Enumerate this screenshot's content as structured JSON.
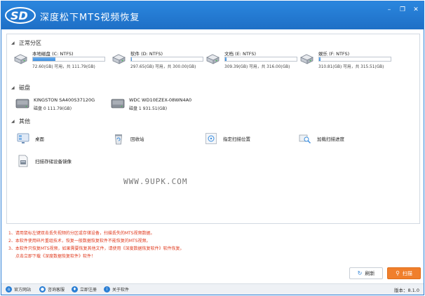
{
  "app": {
    "title": "深度松下MTS视频恢复",
    "logo_text": "SD"
  },
  "window_controls": {
    "minimize": "–",
    "restore": "❐",
    "close": "✕"
  },
  "sections": {
    "partitions": "正常分区",
    "disks": "磁盘",
    "other": "其他"
  },
  "partitions": [
    {
      "name": "本地磁盘 (C: NTFS)",
      "usage": 0.31,
      "size": "72.60(GB) 可用，共 111.79(GB)"
    },
    {
      "name": "软件 (D: NTFS)",
      "usage": 0.01,
      "size": "297.65(GB) 可用，共 300.00(GB)"
    },
    {
      "name": "文档 (E: NTFS)",
      "usage": 0.02,
      "size": "309.39(GB) 可用，共 316.00(GB)"
    },
    {
      "name": "娱乐 (F: NTFS)",
      "usage": 0.02,
      "size": "310.81(GB) 可用，共 315.51(GB)"
    }
  ],
  "disks": [
    {
      "name": "KINGSTON SA400S37120G",
      "info": "磁盘 0    111.79(GB)"
    },
    {
      "name": "WDC WD10EZEX-08WN4A0",
      "info": "磁盘 1    931.51(GB)"
    }
  ],
  "other_items": {
    "desktop": "桌面",
    "recycle_bin": "回收站",
    "scan_location": "指定扫描位置",
    "load_progress": "加载扫描进度",
    "scan_image": "扫描存储设备镜像"
  },
  "watermark": "WWW.9UPK.COM",
  "notes": [
    "1、请用鼠标左键双击丢失视频的分区或存储设备，扫描丢失的MTS视频数据。",
    "2、本软件使用碎片重组技术，恢复一般数据恢复软件不能恢复的MTS视频。",
    "3、本软件只恢复MTS视频，如果需要恢复其他文件，请使用《深度数据恢复软件》软件恢复。",
    "点击立即下载《深度数据恢复软件》软件！"
  ],
  "buttons": {
    "refresh": "刷新",
    "scan": "扫描"
  },
  "footer": {
    "website": "官方网站",
    "support": "咨询客服",
    "register": "立即注册",
    "about": "关于软件",
    "version": "版本：8.1.0"
  },
  "colors": {
    "titlebar": "#1e6fc6",
    "accent": "#f07f2c",
    "note_text": "#e03a1e"
  }
}
